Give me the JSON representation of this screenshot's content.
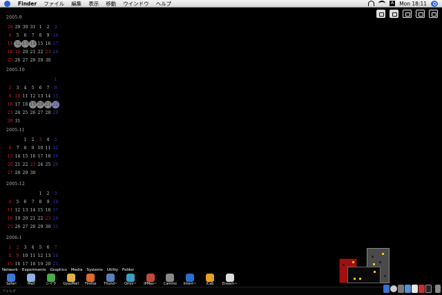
{
  "menubar": {
    "app": "Finder",
    "items": [
      "ファイル",
      "編集",
      "表示",
      "移動",
      "ウインドウ",
      "ヘルプ"
    ],
    "clock": "Mon 18:11",
    "input_indicator": "A"
  },
  "calendars": [
    {
      "title": "2005-9",
      "days": [
        {
          "t": "28",
          "c": "sun"
        },
        {
          "t": "29"
        },
        {
          "t": "30"
        },
        {
          "t": "31"
        },
        {
          "t": "1"
        },
        {
          "t": "2"
        },
        {
          "t": "3",
          "c": "sat"
        },
        {
          "t": "4",
          "c": "sun"
        },
        {
          "t": "5",
          "c": "today"
        },
        {
          "t": "6"
        },
        {
          "t": "7"
        },
        {
          "t": "8"
        },
        {
          "t": "9"
        },
        {
          "t": "10",
          "c": "sat"
        },
        {
          "t": "11",
          "c": "sun"
        },
        {
          "t": "12",
          "c": "hl"
        },
        {
          "t": "13",
          "c": "hl"
        },
        {
          "t": "14",
          "c": "hl"
        },
        {
          "t": "15"
        },
        {
          "t": "16"
        },
        {
          "t": "17",
          "c": "sat"
        },
        {
          "t": "18",
          "c": "sun"
        },
        {
          "t": "19",
          "c": "hol"
        },
        {
          "t": "20"
        },
        {
          "t": "21"
        },
        {
          "t": "22"
        },
        {
          "t": "23",
          "c": "hol"
        },
        {
          "t": "24",
          "c": "sat"
        },
        {
          "t": "25",
          "c": "sun"
        },
        {
          "t": "26"
        },
        {
          "t": "27"
        },
        {
          "t": "28"
        },
        {
          "t": "29"
        },
        {
          "t": "30"
        },
        {
          "t": ""
        }
      ]
    },
    {
      "title": "2005-10",
      "days": [
        {
          "t": ""
        },
        {
          "t": ""
        },
        {
          "t": ""
        },
        {
          "t": ""
        },
        {
          "t": ""
        },
        {
          "t": ""
        },
        {
          "t": "1",
          "c": "sat"
        },
        {
          "t": "2",
          "c": "sun"
        },
        {
          "t": "3"
        },
        {
          "t": "4"
        },
        {
          "t": "5"
        },
        {
          "t": "6"
        },
        {
          "t": "7"
        },
        {
          "t": "8",
          "c": "sat"
        },
        {
          "t": "9",
          "c": "sun"
        },
        {
          "t": "10",
          "c": "hol"
        },
        {
          "t": "11"
        },
        {
          "t": "12"
        },
        {
          "t": "13"
        },
        {
          "t": "14"
        },
        {
          "t": "15",
          "c": "sat"
        },
        {
          "t": "16",
          "c": "sun"
        },
        {
          "t": "17"
        },
        {
          "t": "18"
        },
        {
          "t": "19",
          "c": "hl"
        },
        {
          "t": "20",
          "c": "hl"
        },
        {
          "t": "21",
          "c": "hl"
        },
        {
          "t": "22",
          "c": "hl sat"
        },
        {
          "t": "23",
          "c": "sun"
        },
        {
          "t": "24"
        },
        {
          "t": "25"
        },
        {
          "t": "26"
        },
        {
          "t": "27"
        },
        {
          "t": "28"
        },
        {
          "t": "29",
          "c": "sat"
        },
        {
          "t": "30",
          "c": "sun"
        },
        {
          "t": "31"
        }
      ]
    },
    {
      "title": "2005-11",
      "days": [
        {
          "t": ""
        },
        {
          "t": ""
        },
        {
          "t": "1"
        },
        {
          "t": "2"
        },
        {
          "t": "3",
          "c": "hol"
        },
        {
          "t": "4"
        },
        {
          "t": "5",
          "c": "sat"
        },
        {
          "t": "6",
          "c": "sun"
        },
        {
          "t": "7"
        },
        {
          "t": "8"
        },
        {
          "t": "9"
        },
        {
          "t": "10"
        },
        {
          "t": "11"
        },
        {
          "t": "12",
          "c": "sat"
        },
        {
          "t": "13",
          "c": "sun"
        },
        {
          "t": "14"
        },
        {
          "t": "15"
        },
        {
          "t": "16"
        },
        {
          "t": "17"
        },
        {
          "t": "18"
        },
        {
          "t": "19",
          "c": "sat"
        },
        {
          "t": "20",
          "c": "sun"
        },
        {
          "t": "21"
        },
        {
          "t": "22"
        },
        {
          "t": "23",
          "c": "hol"
        },
        {
          "t": "24"
        },
        {
          "t": "25"
        },
        {
          "t": "26",
          "c": "sat"
        },
        {
          "t": "27",
          "c": "sun"
        },
        {
          "t": "28"
        },
        {
          "t": "29"
        },
        {
          "t": "30"
        }
      ]
    },
    {
      "title": "2005-12",
      "days": [
        {
          "t": ""
        },
        {
          "t": ""
        },
        {
          "t": ""
        },
        {
          "t": ""
        },
        {
          "t": "1"
        },
        {
          "t": "2"
        },
        {
          "t": "3",
          "c": "sat"
        },
        {
          "t": "4",
          "c": "sun"
        },
        {
          "t": "5"
        },
        {
          "t": "6"
        },
        {
          "t": "7"
        },
        {
          "t": "8"
        },
        {
          "t": "9"
        },
        {
          "t": "10",
          "c": "sat"
        },
        {
          "t": "11",
          "c": "sun"
        },
        {
          "t": "12"
        },
        {
          "t": "13"
        },
        {
          "t": "14"
        },
        {
          "t": "15"
        },
        {
          "t": "16"
        },
        {
          "t": "17",
          "c": "sat"
        },
        {
          "t": "18",
          "c": "sun"
        },
        {
          "t": "19"
        },
        {
          "t": "20"
        },
        {
          "t": "21"
        },
        {
          "t": "22"
        },
        {
          "t": "23",
          "c": "hol"
        },
        {
          "t": "24",
          "c": "sat"
        },
        {
          "t": "25",
          "c": "sun"
        },
        {
          "t": "26"
        },
        {
          "t": "27"
        },
        {
          "t": "28"
        },
        {
          "t": "29"
        },
        {
          "t": "30"
        },
        {
          "t": "31",
          "c": "sat"
        }
      ]
    },
    {
      "title": "2006-1",
      "days": [
        {
          "t": "1",
          "c": "sun"
        },
        {
          "t": "2",
          "c": "hol"
        },
        {
          "t": "3"
        },
        {
          "t": "4"
        },
        {
          "t": "5"
        },
        {
          "t": "6"
        },
        {
          "t": "7",
          "c": "sat"
        },
        {
          "t": "8",
          "c": "sun"
        },
        {
          "t": "9",
          "c": "hol"
        },
        {
          "t": "10"
        },
        {
          "t": "11"
        },
        {
          "t": "12"
        },
        {
          "t": "13"
        },
        {
          "t": "14",
          "c": "sat"
        },
        {
          "t": "15",
          "c": "sun"
        },
        {
          "t": "16"
        },
        {
          "t": "17"
        },
        {
          "t": "18"
        },
        {
          "t": "19"
        },
        {
          "t": "20"
        },
        {
          "t": "21",
          "c": "sat"
        }
      ]
    }
  ],
  "shelf_tabs": [
    "Network",
    "Experiments",
    "Graphics",
    "Media",
    "Systems",
    "Utility",
    "Folder"
  ],
  "dock_apps": [
    {
      "label": "Safari",
      "color": "#3b7bd8"
    },
    {
      "label": "Mail",
      "color": "#8fb3e0"
    },
    {
      "label": "シイラ",
      "color": "#4caa48"
    },
    {
      "label": "GyazMail",
      "color": "#e0b048"
    },
    {
      "label": "Firefox",
      "color": "#e06a2a"
    },
    {
      "label": "Thund~",
      "color": "#5a7fb8"
    },
    {
      "label": "Omni~",
      "color": "#3aa0c8"
    },
    {
      "label": "IPMes~",
      "color": "#c04a3a"
    },
    {
      "label": "Camino",
      "color": "#888888"
    },
    {
      "label": "Intern~",
      "color": "#2a6fd0"
    },
    {
      "label": "iCab",
      "color": "#e8a020"
    },
    {
      "label": "Eneam~",
      "color": "#dddddd"
    }
  ],
  "bottom_hint": "フォルダ"
}
